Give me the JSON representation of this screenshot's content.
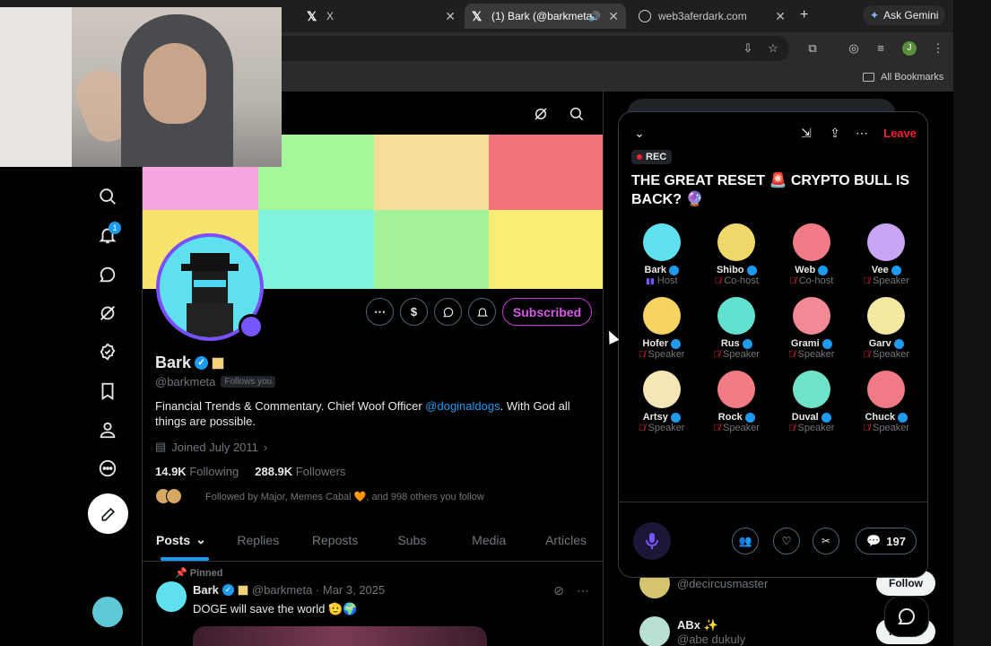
{
  "browser": {
    "tabs": [
      {
        "title": "X",
        "active": false
      },
      {
        "title": "(1) Bark (@barkmeta",
        "active": true
      },
      {
        "title": "web3aferdark.com",
        "active": false
      }
    ],
    "ask_gemini": "Ask Gemini",
    "all_bookmarks": "All Bookmarks",
    "profile_initial": "J"
  },
  "profile": {
    "name": "Bark",
    "handle": "@barkmeta",
    "follows_you": "Follows you",
    "bio_pre": "Financial Trends & Commentary. Chief Woof Officer ",
    "bio_mention": "@doginaldogs",
    "bio_post": ". With God all things are possible.",
    "joined": "Joined July 2011",
    "following_count": "14.9K",
    "following_label": "Following",
    "followers_count": "288.9K",
    "followers_label": "Followers",
    "followed_by": "Followed by Major, Memes Cabal 🧡, and 998 others you follow",
    "subscribed": "Subscribed",
    "banner_colors": [
      "#f5a6e0",
      "#a6f79a",
      "#f6dd98",
      "#f2727c",
      "#f8e46c",
      "#7ff3dc",
      "#a3f29a",
      "#f8ee74"
    ]
  },
  "tabs": [
    "Posts",
    "Replies",
    "Reposts",
    "Subs",
    "Media",
    "Articles"
  ],
  "pinned_post": {
    "pinned_label": "Pinned",
    "name": "Bark",
    "meta": "@barkmeta · Mar 3, 2025",
    "text": "DOGE will save the world 🫡🌍"
  },
  "nav": {
    "notification_count": "1"
  },
  "space": {
    "rec_label": "REC",
    "leave": "Leave",
    "title": "THE GREAT RESET 🚨 CRYPTO BULL IS BACK? 🔮",
    "comment_count": "197",
    "participants": [
      {
        "name": "Bark",
        "role": "Host",
        "color": "#5ee0ef"
      },
      {
        "name": "Shibo",
        "role": "Co-host",
        "color": "#f1d86a"
      },
      {
        "name": "Web",
        "role": "Co-host",
        "color": "#f07a86"
      },
      {
        "name": "Vee",
        "role": "Speaker",
        "color": "#c9a6f5"
      },
      {
        "name": "Hofer",
        "role": "Speaker",
        "color": "#f6d463"
      },
      {
        "name": "Rus",
        "role": "Speaker",
        "color": "#62e0d0"
      },
      {
        "name": "Grami",
        "role": "Speaker",
        "color": "#f28a96"
      },
      {
        "name": "Garv",
        "role": "Speaker",
        "color": "#f3e8a0"
      },
      {
        "name": "Artsy",
        "role": "Speaker",
        "color": "#f5e6b8"
      },
      {
        "name": "Rock",
        "role": "Speaker",
        "color": "#f27c86"
      },
      {
        "name": "Duval",
        "role": "Speaker",
        "color": "#6ee3c8"
      },
      {
        "name": "Chuck",
        "role": "Speaker",
        "color": "#f07a86"
      }
    ]
  },
  "who_to_follow": [
    {
      "name": "",
      "handle": "@decircusmaster",
      "follow": "Follow"
    },
    {
      "name": "ABx ✨",
      "handle": "@abe dukuly",
      "follow": "Follow"
    }
  ]
}
